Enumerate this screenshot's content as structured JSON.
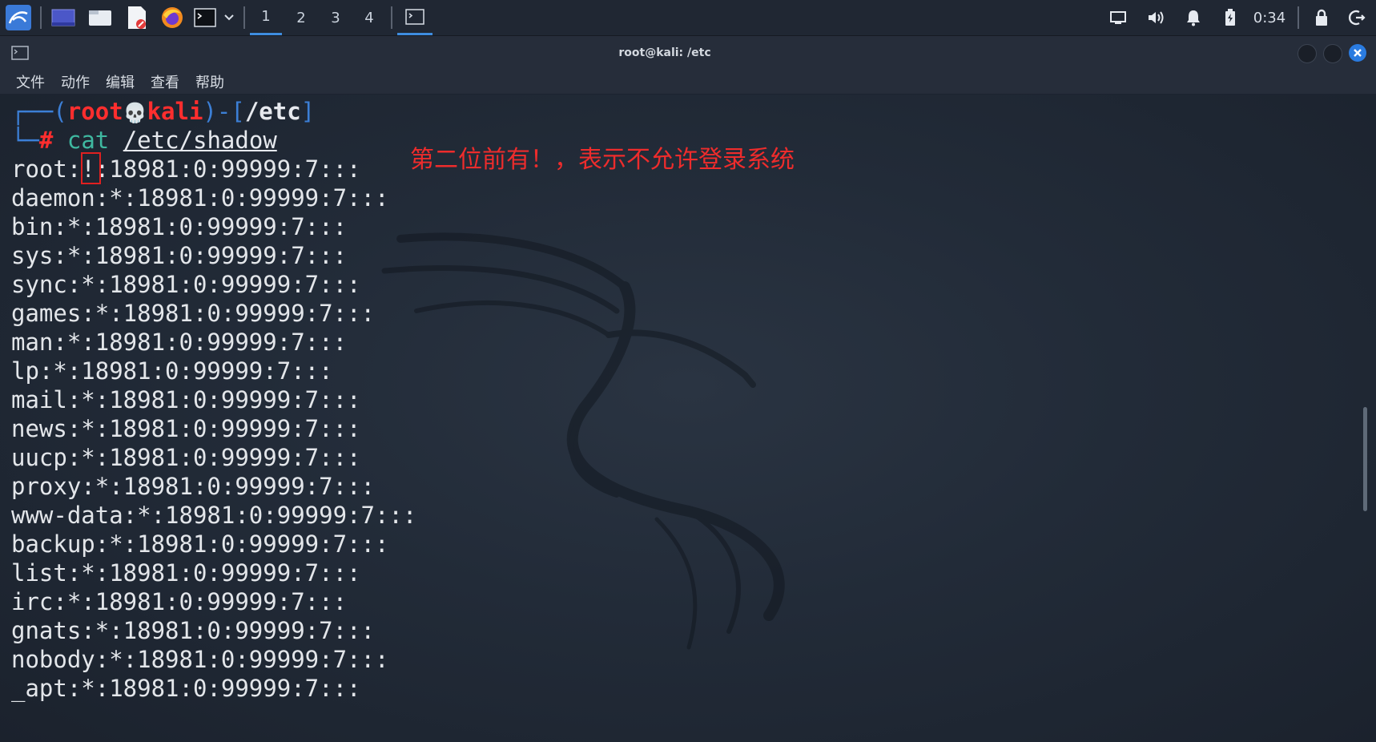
{
  "taskbar": {
    "workspaces": [
      "1",
      "2",
      "3",
      "4"
    ],
    "active_workspace": "1",
    "clock": "0:34"
  },
  "window": {
    "title": "root@kali: /etc"
  },
  "menubar": {
    "items": [
      "文件",
      "动作",
      "编辑",
      "查看",
      "帮助"
    ]
  },
  "terminal": {
    "prompt": {
      "user": "root",
      "skull": "💀",
      "host": "kali",
      "cwd": "/etc",
      "hash": "#",
      "command": "cat",
      "argument": "/etc/shadow"
    },
    "output_first_user": "root",
    "output_first_mark": "!",
    "output_first_rest": ":18981:0:99999:7:::",
    "output_lines": [
      "daemon:*:18981:0:99999:7:::",
      "bin:*:18981:0:99999:7:::",
      "sys:*:18981:0:99999:7:::",
      "sync:*:18981:0:99999:7:::",
      "games:*:18981:0:99999:7:::",
      "man:*:18981:0:99999:7:::",
      "lp:*:18981:0:99999:7:::",
      "mail:*:18981:0:99999:7:::",
      "news:*:18981:0:99999:7:::",
      "uucp:*:18981:0:99999:7:::",
      "proxy:*:18981:0:99999:7:::",
      "www-data:*:18981:0:99999:7:::",
      "backup:*:18981:0:99999:7:::",
      "list:*:18981:0:99999:7:::",
      "irc:*:18981:0:99999:7:::",
      "gnats:*:18981:0:99999:7:::",
      "nobody:*:18981:0:99999:7:::",
      "_apt:*:18981:0:99999:7:::"
    ],
    "annotation": "第二位前有！，表示不允许登录系统"
  },
  "colors": {
    "accent": "#3e8de0",
    "prompt_red": "#ff2e2e",
    "annotation_red": "#ee2c2c",
    "command_teal": "#3fb8a0"
  }
}
